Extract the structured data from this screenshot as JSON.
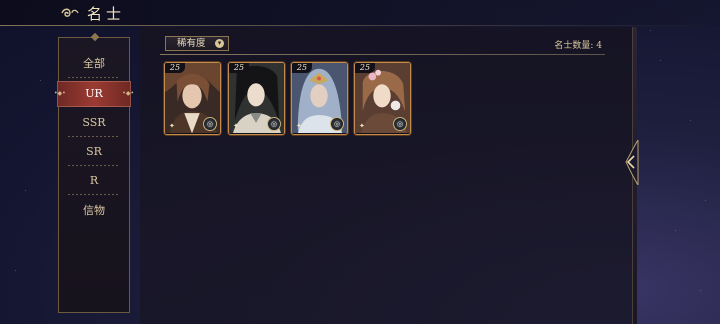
{
  "header": {
    "title": "名士"
  },
  "sidebar": {
    "items": [
      {
        "label": "全部",
        "active": false
      },
      {
        "label": "UR",
        "active": true
      },
      {
        "label": "SSR",
        "active": false
      },
      {
        "label": "SR",
        "active": false
      },
      {
        "label": "R",
        "active": false
      },
      {
        "label": "信物",
        "active": false
      }
    ]
  },
  "toolbar": {
    "filter_label": "稀有度",
    "count_text": "名士数量: 4"
  },
  "cards": [
    {
      "level": "25",
      "art": "brown-hair-warrior-portrait"
    },
    {
      "level": "25",
      "art": "black-hair-scholar-portrait"
    },
    {
      "level": "25",
      "art": "silver-hair-masked-portrait"
    },
    {
      "level": "25",
      "art": "flower-crown-lady-portrait"
    }
  ],
  "colors": {
    "accent_gold": "#c58b4a",
    "active_red": "#9b3b33",
    "background": "#141530"
  }
}
